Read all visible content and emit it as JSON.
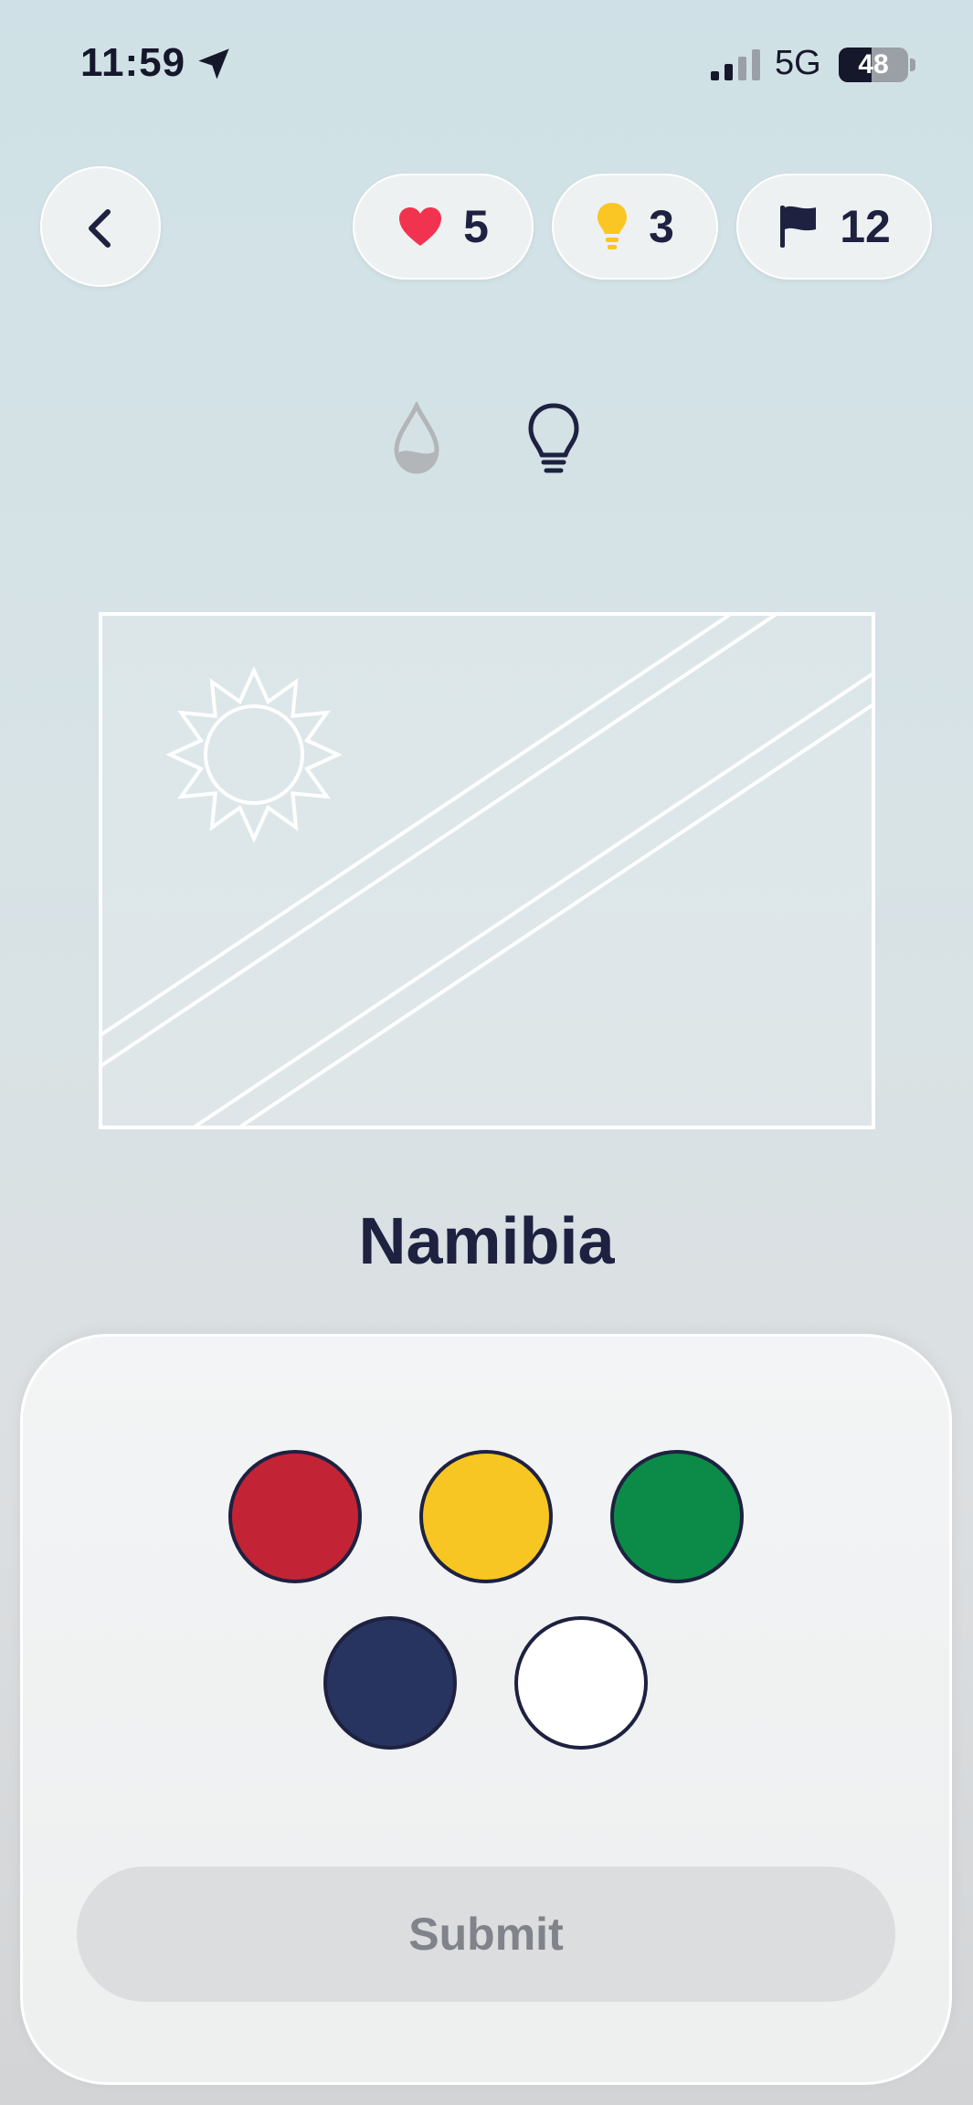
{
  "status_bar": {
    "time": "11:59",
    "network": "5G",
    "battery": "48",
    "battery_level": 0.48
  },
  "header": {
    "back_icon": "chevron-left-icon",
    "lives": {
      "icon": "heart-icon",
      "value": "5",
      "color": "#f2334f"
    },
    "hints": {
      "icon": "lightbulb-icon",
      "value": "3",
      "color": "#f9c623"
    },
    "flags": {
      "icon": "flag-icon",
      "value": "12",
      "color": "#1e2140"
    }
  },
  "tools": [
    {
      "icon": "paint-drop-icon"
    },
    {
      "icon": "lightbulb-outline-icon"
    }
  ],
  "country": "Namibia",
  "palette": [
    {
      "name": "red",
      "color": "#c22436"
    },
    {
      "name": "yellow",
      "color": "#f7c622"
    },
    {
      "name": "green",
      "color": "#0b8b47"
    },
    {
      "name": "navy",
      "color": "#283460"
    },
    {
      "name": "white",
      "color": "#ffffff"
    }
  ],
  "submit_label": "Submit"
}
